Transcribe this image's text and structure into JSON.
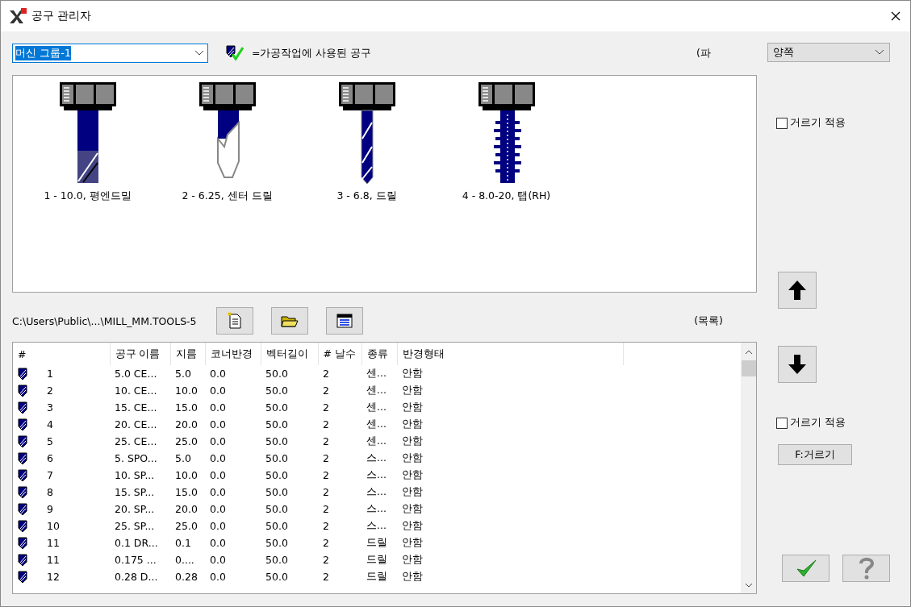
{
  "window": {
    "title": "공구 관리자"
  },
  "machine_group": {
    "value": "머신 그룹-1",
    "focused": true
  },
  "legend": {
    "text": "=가공작업에 사용된 공구"
  },
  "filter_label": "(파",
  "side_select": {
    "value": "양쪽"
  },
  "tools": [
    {
      "kind": "endmill",
      "label": "1 - 10.0, 평엔드밀"
    },
    {
      "kind": "centerdrill",
      "label": "2 - 6.25, 센터 드릴"
    },
    {
      "kind": "drill",
      "label": "3 - 6.8, 드릴"
    },
    {
      "kind": "tap",
      "label": "4 - 8.0-20, 탭(RH)"
    }
  ],
  "filter_top": {
    "label": "거르기 적용",
    "checked": false
  },
  "library_path": "C:\\Users\\Public\\...\\MILL_MM.TOOLS-5",
  "list_label": "(목록)",
  "table": {
    "columns": [
      "#",
      "공구 이름",
      "지름",
      "코너반경",
      "벡터길이",
      "# 날수",
      "종류",
      "반경형태"
    ],
    "rows": [
      [
        "1",
        "5.0 CE...",
        "5.0",
        "0.0",
        "50.0",
        "2",
        "센...",
        "안함"
      ],
      [
        "2",
        "10. CE...",
        "10.0",
        "0.0",
        "50.0",
        "2",
        "센...",
        "안함"
      ],
      [
        "3",
        "15. CE...",
        "15.0",
        "0.0",
        "50.0",
        "2",
        "센...",
        "안함"
      ],
      [
        "4",
        "20. CE...",
        "20.0",
        "0.0",
        "50.0",
        "2",
        "센...",
        "안함"
      ],
      [
        "5",
        "25. CE...",
        "25.0",
        "0.0",
        "50.0",
        "2",
        "센...",
        "안함"
      ],
      [
        "6",
        "5. SPO...",
        "5.0",
        "0.0",
        "50.0",
        "2",
        "스...",
        "안함"
      ],
      [
        "7",
        "10. SP...",
        "10.0",
        "0.0",
        "50.0",
        "2",
        "스...",
        "안함"
      ],
      [
        "8",
        "15. SP...",
        "15.0",
        "0.0",
        "50.0",
        "2",
        "스...",
        "안함"
      ],
      [
        "9",
        "20. SP...",
        "20.0",
        "0.0",
        "50.0",
        "2",
        "스...",
        "안함"
      ],
      [
        "10",
        "25. SP...",
        "25.0",
        "0.0",
        "50.0",
        "2",
        "스...",
        "안함"
      ],
      [
        "11",
        "0.1 DR...",
        "0.1",
        "0.0",
        "50.0",
        "2",
        "드릴",
        "안함"
      ],
      [
        "11",
        "0.175 ...",
        "0....",
        "0.0",
        "50.0",
        "2",
        "드릴",
        "안함"
      ],
      [
        "12",
        "0.28 D...",
        "0.28",
        "0.0",
        "50.0",
        "2",
        "드릴",
        "안함"
      ]
    ]
  },
  "filter_bottom": {
    "label": "거르기 적용",
    "checked": false
  },
  "filter_button": "F:거르기"
}
